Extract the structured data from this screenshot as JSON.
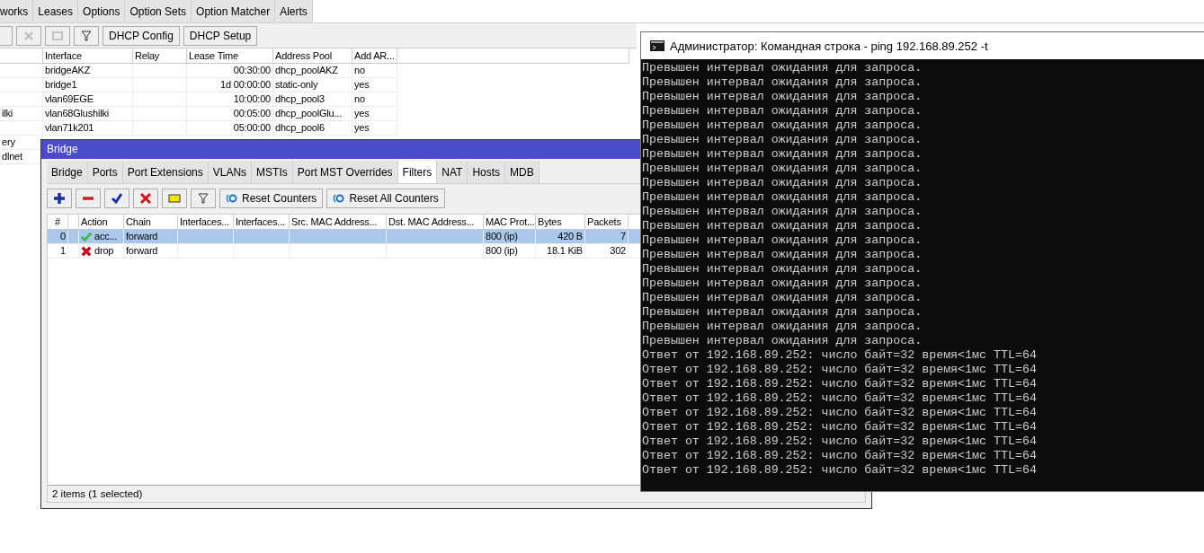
{
  "dhcp_window": {
    "tabs": [
      "works",
      "Leases",
      "Options",
      "Option Sets",
      "Option Matcher",
      "Alerts"
    ],
    "toolbar": {
      "buttons": [
        "DHCP Config",
        "DHCP Setup"
      ]
    },
    "table": {
      "columns": [
        "",
        "Interface",
        "Relay",
        "Lease Time",
        "Address Pool",
        "Add AR..."
      ],
      "rows": [
        {
          "cells": [
            "",
            "bridgeAKZ",
            "",
            "00:30:00",
            "dhcp_poolAKZ",
            "no"
          ]
        },
        {
          "cells": [
            "",
            "bridge1",
            "",
            "1d 00:00:00",
            "static-only",
            "yes"
          ]
        },
        {
          "cells": [
            "",
            "vlan69EGE",
            "",
            "10:00:00",
            "dhcp_pool3",
            "no"
          ]
        },
        {
          "cells": [
            "ilki",
            "vlan68Glushilki",
            "",
            "00:05:00",
            "dhcp_poolGlu...",
            "yes"
          ]
        },
        {
          "cells": [
            "",
            "vlan71k201",
            "",
            "05:00:00",
            "dhcp_pool6",
            "yes"
          ]
        },
        {
          "cells": [
            "ery"
          ]
        },
        {
          "cells": [
            "dlnet"
          ]
        }
      ]
    }
  },
  "bridge_window": {
    "title": "Bridge",
    "tabs": [
      {
        "label": "Bridge",
        "selected": false
      },
      {
        "label": "Ports",
        "selected": false
      },
      {
        "label": "Port Extensions",
        "selected": false
      },
      {
        "label": "VLANs",
        "selected": false
      },
      {
        "label": "MSTIs",
        "selected": false
      },
      {
        "label": "Port MST Overrides",
        "selected": false
      },
      {
        "label": "Filters",
        "selected": true
      },
      {
        "label": "NAT",
        "selected": false
      },
      {
        "label": "Hosts",
        "selected": false
      },
      {
        "label": "MDB",
        "selected": false
      }
    ],
    "toolbar": {
      "buttons": [
        "Reset Counters",
        "Reset All Counters"
      ]
    },
    "table": {
      "columns": [
        "#",
        "",
        "Action",
        "Chain",
        "Interfaces...",
        "Interfaces...",
        "Src. MAC Address...",
        "Dst. MAC Address...",
        "MAC Prot...",
        "Bytes",
        "Packets"
      ],
      "rows": [
        {
          "selected": true,
          "kind": "accept",
          "cells": [
            "0",
            "",
            "acc...",
            "forward",
            "",
            "",
            "",
            "",
            "800 (ip)",
            "420 B",
            "7"
          ]
        },
        {
          "selected": false,
          "kind": "drop",
          "cells": [
            "1",
            "",
            "drop",
            "forward",
            "",
            "",
            "",
            "",
            "800 (ip)",
            "18.1 KiB",
            "302"
          ]
        }
      ]
    },
    "status_bar": "2 items (1 selected)"
  },
  "console_window": {
    "title": "Администратор: Командная строка - ping  192.168.89.252 -t",
    "lines": [
      "Превышен интервал ожидания для запроса.",
      "Превышен интервал ожидания для запроса.",
      "Превышен интервал ожидания для запроса.",
      "Превышен интервал ожидания для запроса.",
      "Превышен интервал ожидания для запроса.",
      "Превышен интервал ожидания для запроса.",
      "Превышен интервал ожидания для запроса.",
      "Превышен интервал ожидания для запроса.",
      "Превышен интервал ожидания для запроса.",
      "Превышен интервал ожидания для запроса.",
      "Превышен интервал ожидания для запроса.",
      "Превышен интервал ожидания для запроса.",
      "Превышен интервал ожидания для запроса.",
      "Превышен интервал ожидания для запроса.",
      "Превышен интервал ожидания для запроса.",
      "Превышен интервал ожидания для запроса.",
      "Превышен интервал ожидания для запроса.",
      "Превышен интервал ожидания для запроса.",
      "Превышен интервал ожидания для запроса.",
      "Превышен интервал ожидания для запроса.",
      "Ответ от 192.168.89.252: число байт=32 время<1мс TTL=64",
      "Ответ от 192.168.89.252: число байт=32 время<1мс TTL=64",
      "Ответ от 192.168.89.252: число байт=32 время<1мс TTL=64",
      "Ответ от 192.168.89.252: число байт=32 время<1мс TTL=64",
      "Ответ от 192.168.89.252: число байт=32 время<1мс TTL=64",
      "Ответ от 192.168.89.252: число байт=32 время<1мс TTL=64",
      "Ответ от 192.168.89.252: число байт=32 время<1мс TTL=64",
      "Ответ от 192.168.89.252: число байт=32 время<1мс TTL=64",
      "Ответ от 192.168.89.252: число байт=32 время<1мс TTL=64"
    ]
  }
}
